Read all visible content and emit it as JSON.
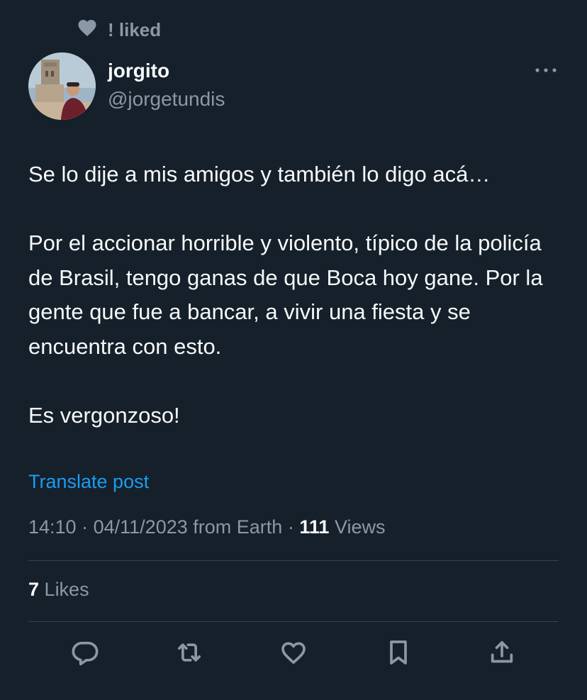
{
  "social_context": {
    "icon": "heart-icon",
    "label": "! liked"
  },
  "author": {
    "avatar": "avatar",
    "display_name": "jorgito",
    "handle": "@jorgetundis"
  },
  "more_icon": "more-dots-icon",
  "tweet": {
    "paragraphs": [
      "Se lo dije a mis amigos y también lo digo acá…",
      "Por el accionar horrible y violento, típico de la policía de Brasil, tengo ganas de que Boca hoy gane. Por la gente que fue a bancar, a vivir una fiesta y se encuentra con esto.",
      "Es vergonzoso!"
    ]
  },
  "translate_label": "Translate post",
  "meta": {
    "time": "14:10",
    "separator": "·",
    "date": "04/11/2023",
    "source": "from Earth",
    "views_count": "111",
    "views_label": "Views"
  },
  "likes": {
    "count": "7",
    "label": "Likes"
  },
  "actions": [
    {
      "icon": "reply-icon"
    },
    {
      "icon": "retweet-icon"
    },
    {
      "icon": "like-icon"
    },
    {
      "icon": "bookmark-icon"
    },
    {
      "icon": "share-icon"
    }
  ],
  "colors": {
    "background": "#15202b",
    "text": "#f7f9f9",
    "secondary": "#8b98a5",
    "link": "#1d9bf0",
    "divider": "#38444d"
  }
}
